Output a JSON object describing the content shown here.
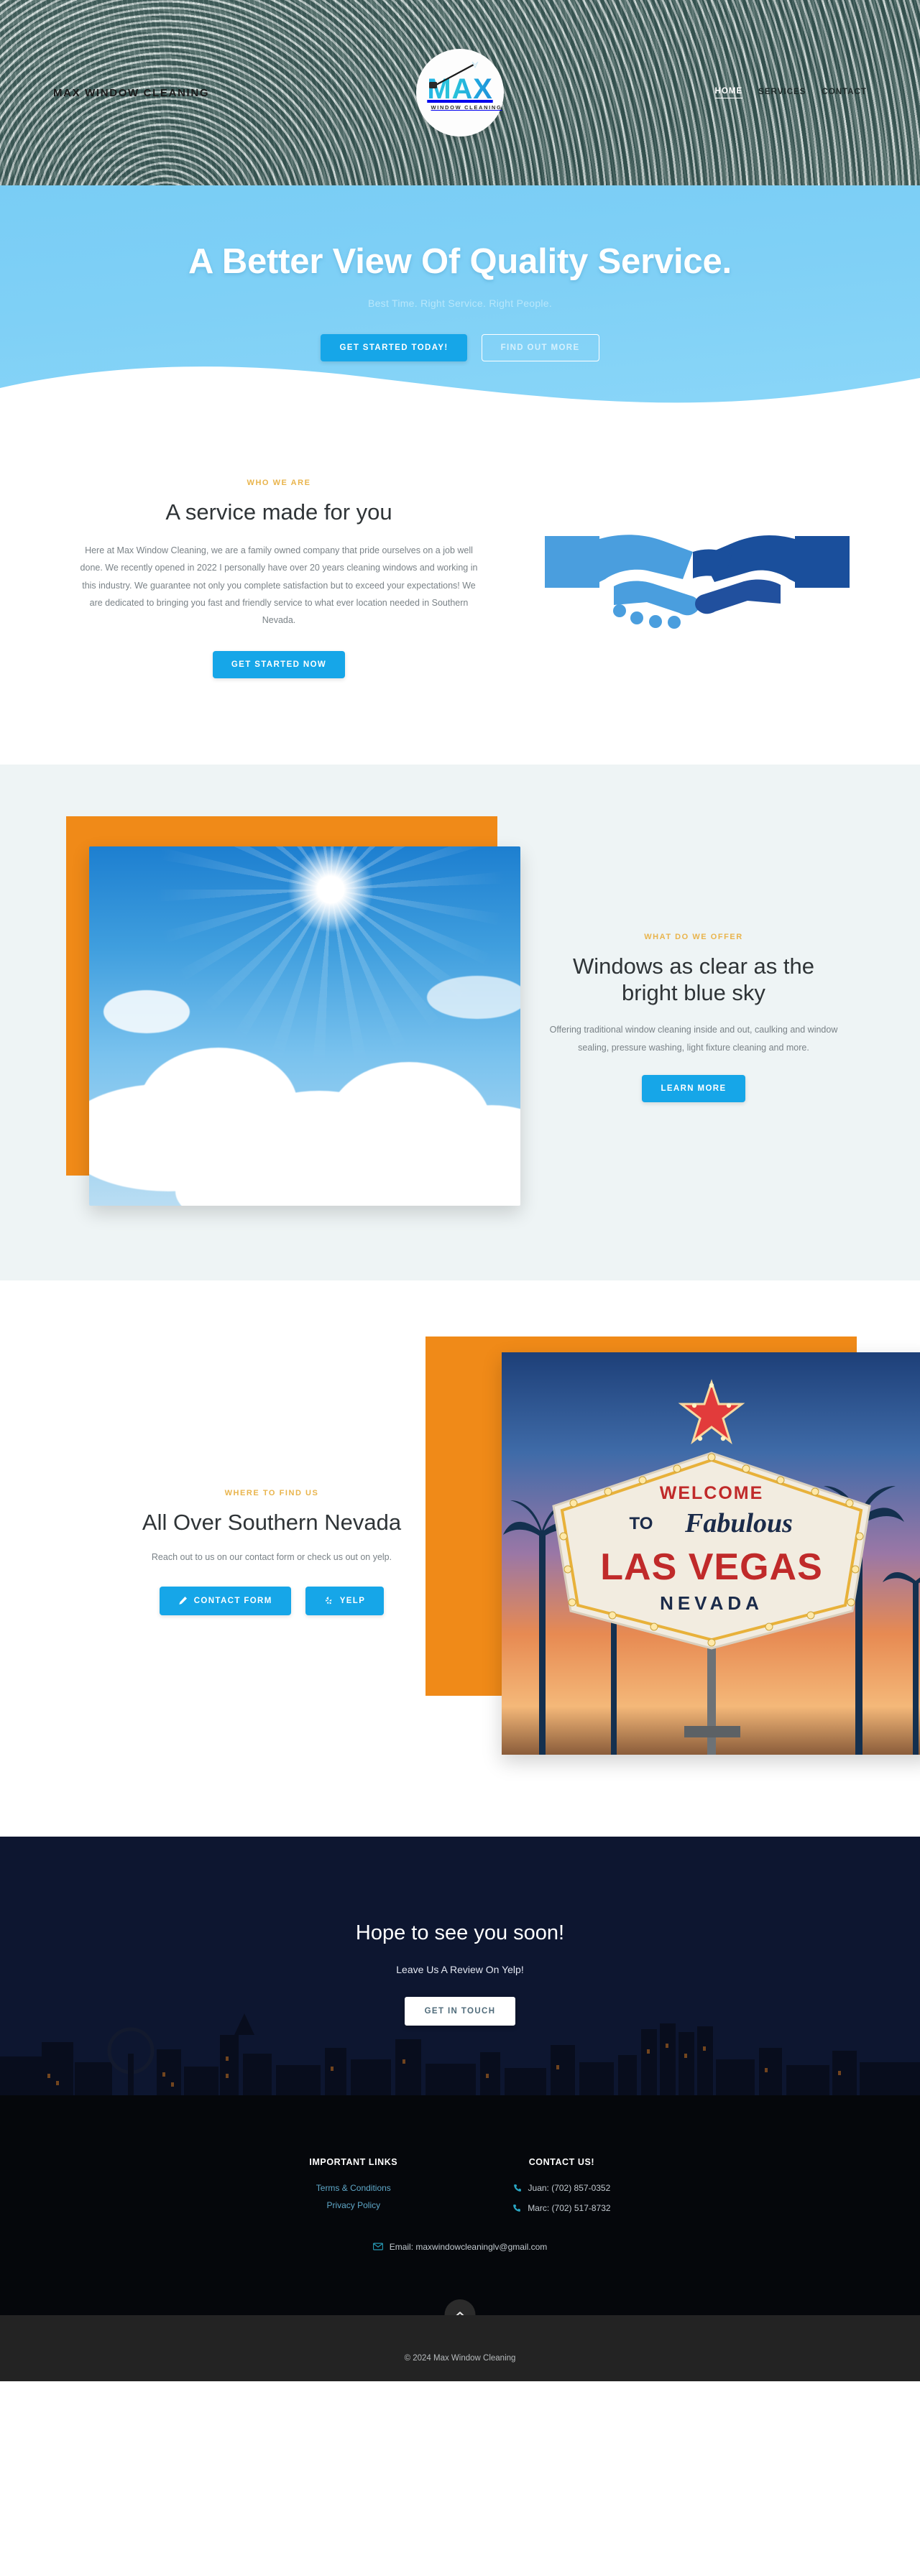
{
  "header": {
    "brand": "MAX WINDOW CLEANING",
    "logo": {
      "word": "MAX",
      "tagline": "WINDOW CLEANING"
    },
    "nav": [
      {
        "label": "HOME",
        "active": true
      },
      {
        "label": "SERVICES",
        "active": false
      },
      {
        "label": "CONTACT",
        "active": false
      }
    ]
  },
  "hero": {
    "title": "A Better View Of Quality Service.",
    "subtitle": "Best Time. Right Service. Right People.",
    "primary_button": "GET STARTED TODAY!",
    "secondary_button": "FIND OUT MORE"
  },
  "about": {
    "eyebrow": "WHO WE ARE",
    "headline": "A service made for you",
    "body": "Here at Max Window Cleaning, we are a family owned company that pride ourselves on a job well done. We recently opened in 2022 I personally have over 20 years cleaning windows and working in this industry. We guarantee not only you complete satisfaction but to exceed your expectations! We are dedicated to bringing you fast and friendly service to what ever location needed in Southern Nevada.",
    "button": "GET STARTED NOW",
    "image_alt": "handshake-illustration"
  },
  "offer": {
    "eyebrow": "WHAT DO WE OFFER",
    "headline": "Windows as clear as the bright blue sky",
    "body": "Offering traditional window cleaning inside and out, caulking and window sealing, pressure washing, light fixture cleaning and more.",
    "button": "LEARN MORE",
    "image_alt": "sun-and-clouds-blue-sky-photo"
  },
  "findus": {
    "eyebrow": "WHERE TO FIND US",
    "headline": "All Over Southern Nevada",
    "body": "Reach out to us on our contact form or check us out on yelp.",
    "buttons": [
      {
        "label": "CONTACT FORM",
        "icon": "pencil-icon"
      },
      {
        "label": "YELP",
        "icon": "yelp-icon"
      }
    ],
    "image_alt": "welcome-to-fabulous-las-vegas-nevada-sign",
    "sign": {
      "welcome": "WELCOME",
      "to": "TO",
      "fabulous": "Fabulous",
      "las_vegas": "LAS VEGAS",
      "nevada": "NEVADA"
    }
  },
  "cta": {
    "title": "Hope to see you soon!",
    "subtitle": "Leave Us A Review On Yelp!",
    "button": "GET IN TOUCH"
  },
  "footer": {
    "links_title": "IMPORTANT LINKS",
    "links": [
      {
        "label": "Terms & Conditions"
      },
      {
        "label": "Privacy Policy"
      }
    ],
    "contact_title": "CONTACT US!",
    "contacts": [
      {
        "icon": "phone-icon",
        "text": "Juan: (702) 857-0352"
      },
      {
        "icon": "phone-icon",
        "text": "Marc: (702) 517-8732"
      }
    ],
    "email": {
      "icon": "envelope-icon",
      "text": "Email: maxwindowcleaninglv@gmail.com"
    },
    "back_to_top_icon": "chevron-up-icon",
    "copyright": "© 2024 Max Window Cleaning"
  },
  "colors": {
    "accent_blue": "#16a6e8",
    "accent_gold": "#e9b44c",
    "accent_orange": "#f08a18",
    "hero_blue": "#7fd0f6",
    "dark_navy": "#0d1630"
  }
}
